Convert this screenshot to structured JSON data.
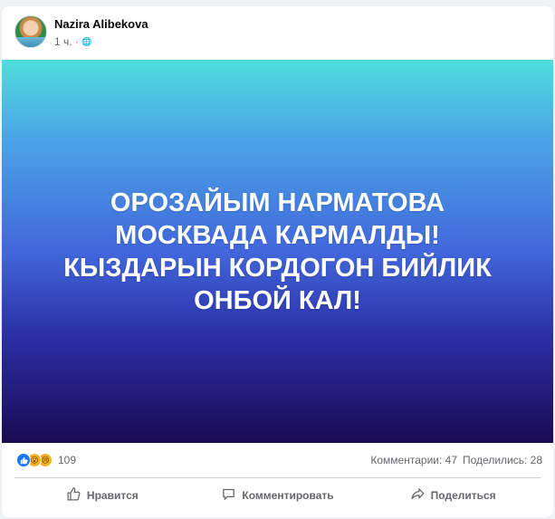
{
  "post": {
    "author": "Nazira Alibekova",
    "time": "1 ч. ·",
    "privacy_icon": "globe-icon",
    "banner_text": "ОРОЗАЙЫМ НАРМАТОВА МОСКВАДА КАРМАЛДЫ! КЫЗДАРЫН КОРДОГОН БИЙЛИК ОНБОЙ КАЛ!",
    "banner_colors": [
      "#4fdedc",
      "#4267dc",
      "#1a0a52"
    ]
  },
  "stats": {
    "reactions": [
      "like-icon",
      "wow-icon",
      "sad-icon"
    ],
    "reaction_count": "109",
    "comments": "Комментарии: 47",
    "shares": "Поделились: 28"
  },
  "actions": {
    "like_label": "Нравится",
    "comment_label": "Комментировать",
    "share_label": "Поделиться"
  }
}
